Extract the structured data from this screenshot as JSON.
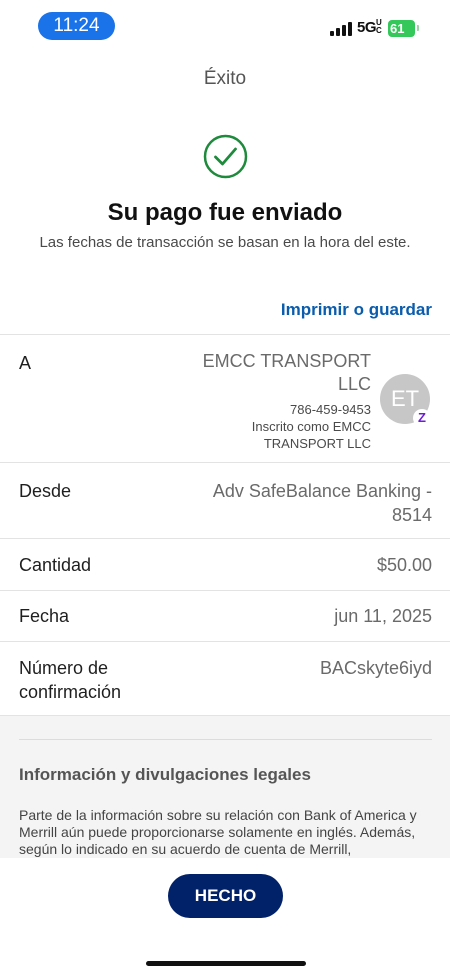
{
  "status_bar": {
    "time": "11:24",
    "network": "5G",
    "network_suffix": "UC",
    "battery": "61"
  },
  "header": {
    "title": "Éxito"
  },
  "icons": {
    "success": "check-circle-icon",
    "zelle": "zelle-badge-icon"
  },
  "colors": {
    "success_green": "#1e8a3c",
    "link_blue": "#0a5cad",
    "button_navy": "#012169",
    "zelle_purple": "#6d1ed4"
  },
  "confirmation": {
    "title": "Su pago fue enviado",
    "subtitle": "Las fechas de transacción se basan en la hora del este."
  },
  "actions": {
    "print_label": "Imprimir o guardar",
    "done_label": "HECHO"
  },
  "details": {
    "to": {
      "label": "A",
      "name": "EMCC TRANSPORT LLC",
      "phone": "786-459-9453",
      "enrolled": "Inscrito como EMCC TRANSPORT LLC",
      "initials": "ET",
      "badge": "Z"
    },
    "from": {
      "label": "Desde",
      "value": "Adv SafeBalance Banking - 8514"
    },
    "amount": {
      "label": "Cantidad",
      "value": "$50.00"
    },
    "date": {
      "label": "Fecha",
      "value": "jun 11, 2025"
    },
    "confirmation_number": {
      "label": "Número de confirmación",
      "value": "BACskyte6iyd"
    }
  },
  "legal": {
    "title": "Información y divulgaciones legales",
    "text": "Parte de la información sobre su relación con Bank of America y Merrill aún puede proporcionarse solamente en inglés. Además, según lo indicado en su acuerdo de cuenta de Merrill,"
  }
}
